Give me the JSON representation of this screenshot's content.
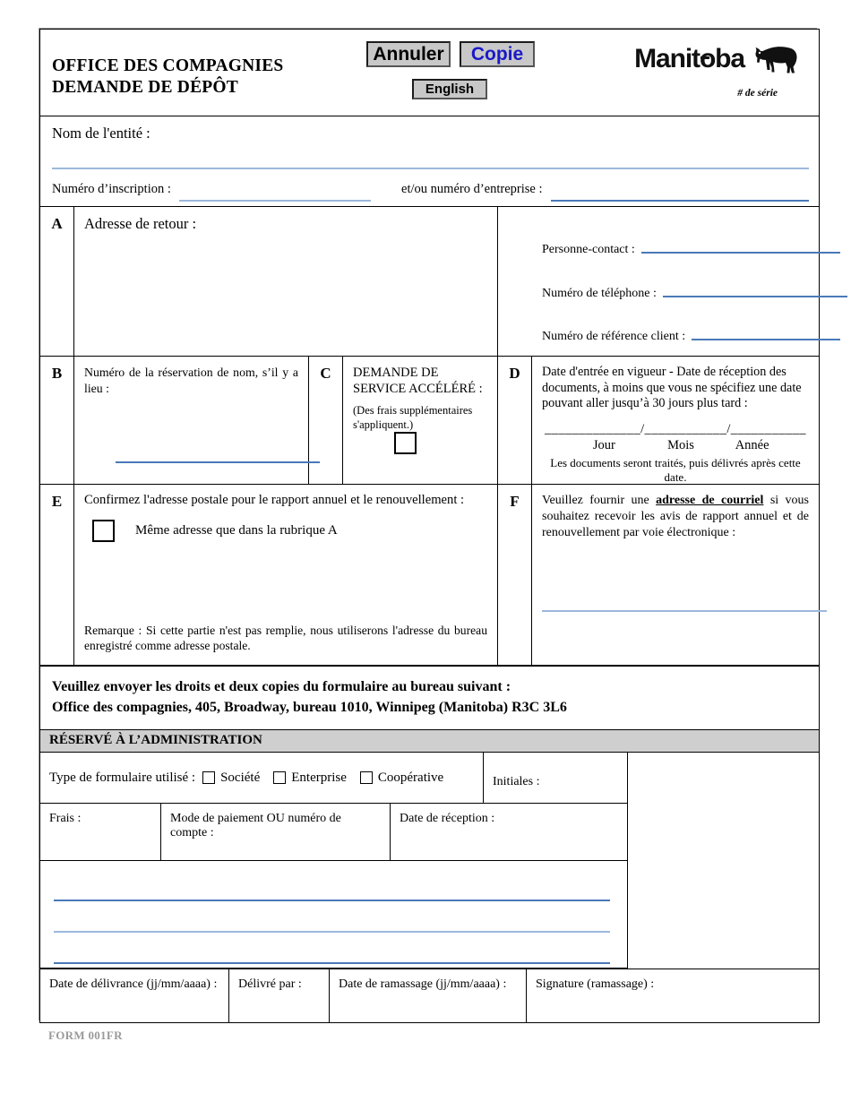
{
  "header": {
    "title_line1": "OFFICE DES COMPAGNIES",
    "title_line2": "DEMANDE DE DÉPÔT",
    "buttons": {
      "cancel": "Annuler",
      "copy": "Copie",
      "language": "English"
    },
    "logo": {
      "wordmark": "Manitoba",
      "icon": "bison-icon"
    },
    "serial_label": "# de série",
    "colors": {
      "copy_text": "#1a19c9",
      "button_face": "#c8c8c8"
    }
  },
  "entity": {
    "name_label": "Nom de l'entité :",
    "name_value": "",
    "registration_label": "Numéro d’inscription :",
    "registration_value": "",
    "business_label": "et/ou numéro d’entreprise :",
    "business_value": ""
  },
  "sections": {
    "a": {
      "letter": "A",
      "title": "Adresse de retour :",
      "address_value": "",
      "fields": [
        {
          "label": "Personne-contact :",
          "value": ""
        },
        {
          "label": "Numéro de téléphone :",
          "value": ""
        },
        {
          "label": "Numéro de référence client :",
          "value": ""
        }
      ]
    },
    "b": {
      "letter": "B",
      "text": "Numéro de la réservation de nom, s’il y a lieu :",
      "value": ""
    },
    "c": {
      "letter": "C",
      "title": "DEMANDE DE SERVICE ACCÉLÉRÉ :",
      "note": "(Des frais supplémentaires s'appliquent.)",
      "checked": false
    },
    "d": {
      "letter": "D",
      "text": "Date d'entrée en vigueur - Date de réception des documents, à moins que vous ne spécifiez une date pouvant aller jusqu’à 30 jours plus tard :",
      "date_blanks": "______________/____________/___________",
      "part_day": "Jour",
      "part_month": "Mois",
      "part_year": "Année",
      "footnote": "Les documents seront traités, puis délivrés après cette date."
    },
    "e": {
      "letter": "E",
      "title": "Confirmez l'adresse postale pour le rapport annuel et le renouvellement :",
      "checkbox_label": "Même adresse que dans la rubrique A",
      "checked": false,
      "note": "Remarque : Si cette partie n'est pas remplie, nous utiliserons l'adresse du bureau enregistré comme adresse postale."
    },
    "f": {
      "letter": "F",
      "text_before": "Veuillez fournir une ",
      "text_emphasis": "adresse de courriel",
      "text_after": " si vous souhaitez recevoir les avis de rapport annuel et de renouvellement par voie électronique :",
      "value": ""
    }
  },
  "mailing": {
    "line1": "Veuillez envoyer les droits et deux copies du formulaire au bureau suivant :",
    "line2": "Office des compagnies, 405, Broadway, bureau 1010, Winnipeg (Manitoba) R3C 3L6"
  },
  "admin": {
    "heading": "RÉSERVÉ À L’ADMINISTRATION",
    "form_type_label": "Type de formulaire utilisé :",
    "form_type_options": [
      "Société",
      "Enterprise",
      "Coopérative"
    ],
    "initials_label": "Initiales :",
    "fees_label": "Frais :",
    "payment_label": "Mode de paiement OU numéro de compte :",
    "reception_label": "Date de réception :",
    "notes_values": [
      "",
      "",
      ""
    ],
    "issue_date_label": "Date de délivrance (jj/mm/aaaa) :",
    "issued_by_label": "Délivré par :",
    "pickup_date_label": "Date de ramassage (jj/mm/aaaa) :",
    "signature_label": "Signature (ramassage) :"
  },
  "footer": {
    "form_code": "FORM 001FR"
  }
}
